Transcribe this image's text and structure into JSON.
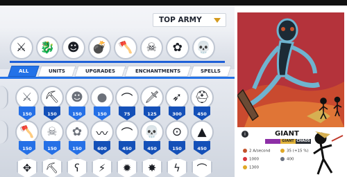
{
  "army_selector": {
    "label": "TOP ARMY"
  },
  "army_slots": [
    {
      "icon": "archer-target-icon",
      "glyph": "⚔"
    },
    {
      "icon": "dragon-icon",
      "glyph": "🐉"
    },
    {
      "icon": "skull-mask-icon",
      "glyph": "☻"
    },
    {
      "icon": "bomb-icon",
      "glyph": "💣"
    },
    {
      "icon": "axe-icon",
      "glyph": "🪓"
    },
    {
      "icon": "skull-crossbones-icon",
      "glyph": "☠"
    },
    {
      "icon": "lungs-icon",
      "glyph": "✿"
    },
    {
      "icon": "skull-icon",
      "glyph": "💀"
    }
  ],
  "tabs": [
    "ALL",
    "UNITS",
    "UPGRADES",
    "ENCHANTMENTS",
    "SPELLS"
  ],
  "units_row1": [
    {
      "icon": "crossbow-icon",
      "glyph": "⚔",
      "cost": "150",
      "locked": true
    },
    {
      "icon": "pickaxe-icon",
      "glyph": "⛏",
      "cost": "150",
      "locked": false
    },
    {
      "icon": "skull-mask-icon",
      "glyph": "☻",
      "cost": "150",
      "locked": true
    },
    {
      "icon": "bomb-icon",
      "glyph": "●",
      "cost": "150",
      "locked": true
    },
    {
      "icon": "scythe-icon",
      "glyph": "⌒",
      "cost": "75",
      "locked": false
    },
    {
      "icon": "sword-icon",
      "glyph": "🗡",
      "cost": "125",
      "locked": false
    },
    {
      "icon": "bow-icon",
      "glyph": "➶",
      "cost": "300",
      "locked": false
    },
    {
      "icon": "helmet-icon",
      "glyph": "⛑",
      "cost": "450",
      "locked": false
    }
  ],
  "units_row2": [
    {
      "icon": "axe-icon",
      "glyph": "🪓",
      "cost": "150",
      "locked": true
    },
    {
      "icon": "skull-crossbones-icon",
      "glyph": "☠",
      "cost": "150",
      "locked": true
    },
    {
      "icon": "lungs-icon",
      "glyph": "✿",
      "cost": "150",
      "locked": true
    },
    {
      "icon": "whip-icon",
      "glyph": "〰",
      "cost": "600",
      "locked": false
    },
    {
      "icon": "hook-icon",
      "glyph": "⌒",
      "cost": "450",
      "locked": false
    },
    {
      "icon": "skull-icon",
      "glyph": "💀",
      "cost": "450",
      "locked": false
    },
    {
      "icon": "bomber-icon",
      "glyph": "⊙",
      "cost": "150",
      "locked": false
    },
    {
      "icon": "witch-hat-icon",
      "glyph": "▲",
      "cost": "450",
      "locked": false
    }
  ],
  "units_row3": [
    {
      "icon": "compass-icon",
      "glyph": "✥"
    },
    {
      "icon": "pickaxe-shield-icon",
      "glyph": "⛏"
    },
    {
      "icon": "bear-icon",
      "glyph": "ʕ"
    },
    {
      "icon": "claw-icon",
      "glyph": "⚡"
    },
    {
      "icon": "bomb-burst-icon",
      "glyph": "✹"
    },
    {
      "icon": "burst-icon",
      "glyph": "✸"
    },
    {
      "icon": "lightning-icon",
      "glyph": "ϟ"
    },
    {
      "icon": "scythe-shield-icon",
      "glyph": "⌒"
    }
  ],
  "detail": {
    "title": "GIANT",
    "tags": [
      "",
      "GIANT",
      "CHAOS"
    ],
    "stats": [
      {
        "icon": "speed-icon",
        "value": "2 A/second"
      },
      {
        "icon": "gold-icon",
        "value": "35 (+15 %)"
      },
      {
        "icon": "heart-icon",
        "value": "1000"
      },
      {
        "icon": "population-icon",
        "value": "400"
      },
      {
        "icon": "coin-icon",
        "value": "1300"
      }
    ]
  }
}
